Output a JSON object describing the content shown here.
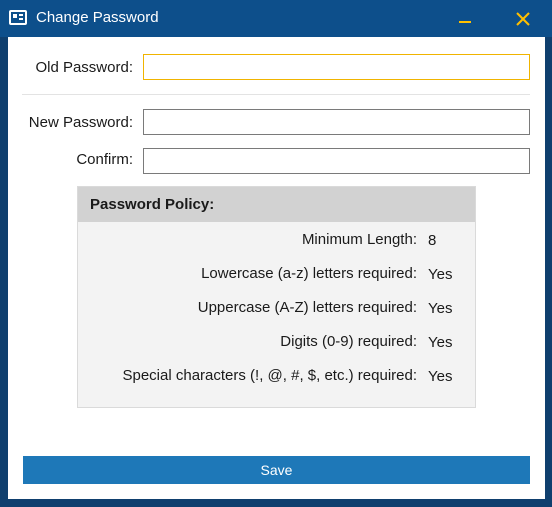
{
  "window": {
    "title": "Change Password"
  },
  "form": {
    "old_password_label": "Old Password:",
    "old_password_value": "",
    "new_password_label": "New Password:",
    "new_password_value": "",
    "confirm_label": "Confirm:",
    "confirm_value": ""
  },
  "policy": {
    "title": "Password Policy:",
    "rules": [
      {
        "label": "Minimum Length:",
        "value": "8"
      },
      {
        "label": "Lowercase (a-z) letters required:",
        "value": "Yes"
      },
      {
        "label": "Uppercase (A-Z) letters required:",
        "value": "Yes"
      },
      {
        "label": "Digits (0-9) required:",
        "value": "Yes"
      },
      {
        "label": "Special characters (!, @, #, $, etc.) required:",
        "value": "Yes"
      }
    ]
  },
  "actions": {
    "save_label": "Save"
  },
  "colors": {
    "titlebar": "#0d4f8b",
    "accent_yellow": "#ffc000",
    "save_button": "#1e78b8",
    "focus_border": "#f0b400"
  }
}
